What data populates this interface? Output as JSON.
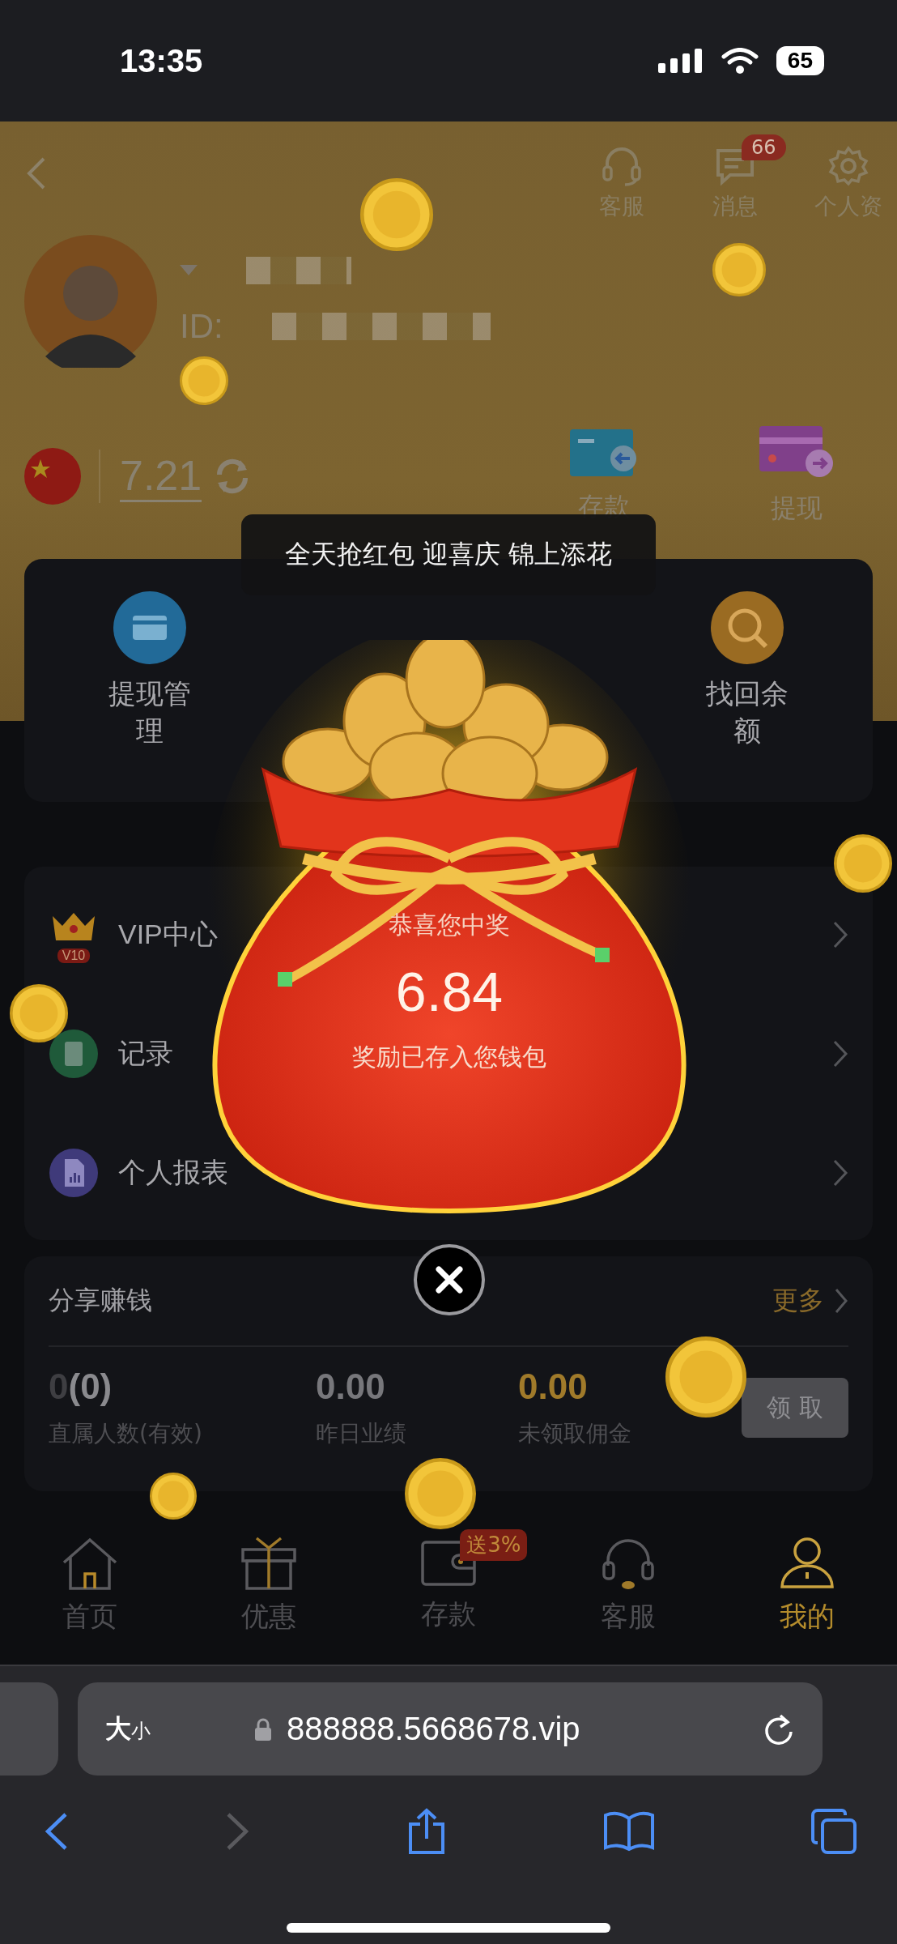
{
  "status_bar": {
    "time": "13:35",
    "battery": "65"
  },
  "header": {
    "actions": [
      {
        "label": "客服",
        "kind": "headset"
      },
      {
        "label": "消息",
        "kind": "message",
        "badge": "66"
      },
      {
        "label": "个人资",
        "kind": "gear"
      }
    ]
  },
  "profile": {
    "id_label": "ID:"
  },
  "wallet": {
    "balance": "7.21",
    "actions": [
      {
        "label": "存款",
        "kind": "deposit"
      },
      {
        "label": "提现",
        "kind": "withdraw"
      }
    ]
  },
  "toast": "全天抢红包 迎喜庆 锦上添花",
  "tools": [
    {
      "label": "提现管理",
      "kind": "card"
    },
    {
      "label": "找回余额",
      "kind": "search"
    }
  ],
  "menu": [
    {
      "label": "VIP中心",
      "kind": "vip",
      "badge": "V10"
    },
    {
      "label": "记录",
      "kind": "record"
    },
    {
      "label": "个人报表",
      "kind": "report"
    }
  ],
  "share": {
    "title": "分享赚钱",
    "more": "更多",
    "claim": "领 取",
    "stats": [
      {
        "value_main": "0",
        "value_sub": "(0)",
        "label": "直属人数(有效)",
        "kind": "count"
      },
      {
        "value_main": "0.00",
        "label": "昨日业绩",
        "kind": "plain"
      },
      {
        "value_main": "0.00",
        "label": "未领取佣金",
        "kind": "gold"
      }
    ]
  },
  "prize": {
    "title": "恭喜您中奖",
    "amount": "6.84",
    "note": "奖励已存入您钱包"
  },
  "nav": [
    {
      "label": "首页",
      "kind": "home",
      "selected": false
    },
    {
      "label": "优惠",
      "kind": "gift",
      "selected": false
    },
    {
      "label": "存款",
      "kind": "wallet",
      "selected": false,
      "badge": "送3%"
    },
    {
      "label": "客服",
      "kind": "headset",
      "selected": false
    },
    {
      "label": "我的",
      "kind": "user",
      "selected": true
    }
  ],
  "browser": {
    "text_size": [
      "大",
      "小"
    ],
    "url": "888888.5668678.vip"
  }
}
